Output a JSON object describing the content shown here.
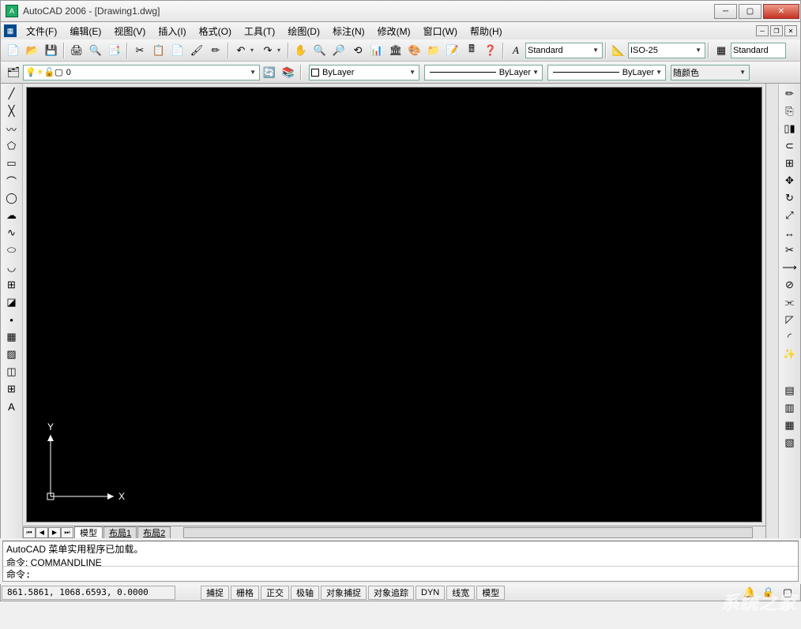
{
  "window": {
    "app_icon_text": "A",
    "title": "AutoCAD 2006 - [Drawing1.dwg]"
  },
  "menu": {
    "items": [
      "文件(F)",
      "编辑(E)",
      "视图(V)",
      "插入(I)",
      "格式(O)",
      "工具(T)",
      "绘图(D)",
      "标注(N)",
      "修改(M)",
      "窗口(W)",
      "帮助(H)"
    ]
  },
  "toolbar_std": {
    "style_label": "Standard",
    "dim_label": "ISO-25",
    "right_label": "Standard"
  },
  "layers": {
    "current": "0",
    "color_combo": "ByLayer",
    "linetype_combo": "ByLayer",
    "lineweight_combo": "ByLayer",
    "plotstyle_combo": "随颜色"
  },
  "tabs": {
    "model": "模型",
    "layout1": "布局1",
    "layout2": "布局2"
  },
  "ucs": {
    "x": "X",
    "y": "Y"
  },
  "command": {
    "history_line1": "AutoCAD 菜单实用程序已加载。",
    "history_line2": "命令: COMMANDLINE",
    "prompt": "命令:"
  },
  "status": {
    "coords": "861.5861, 1068.6593, 0.0000",
    "toggles": [
      "捕捉",
      "栅格",
      "正交",
      "极轴",
      "对象捕捉",
      "对象追踪",
      "DYN",
      "线宽",
      "模型"
    ]
  },
  "watermark": "系统之家"
}
